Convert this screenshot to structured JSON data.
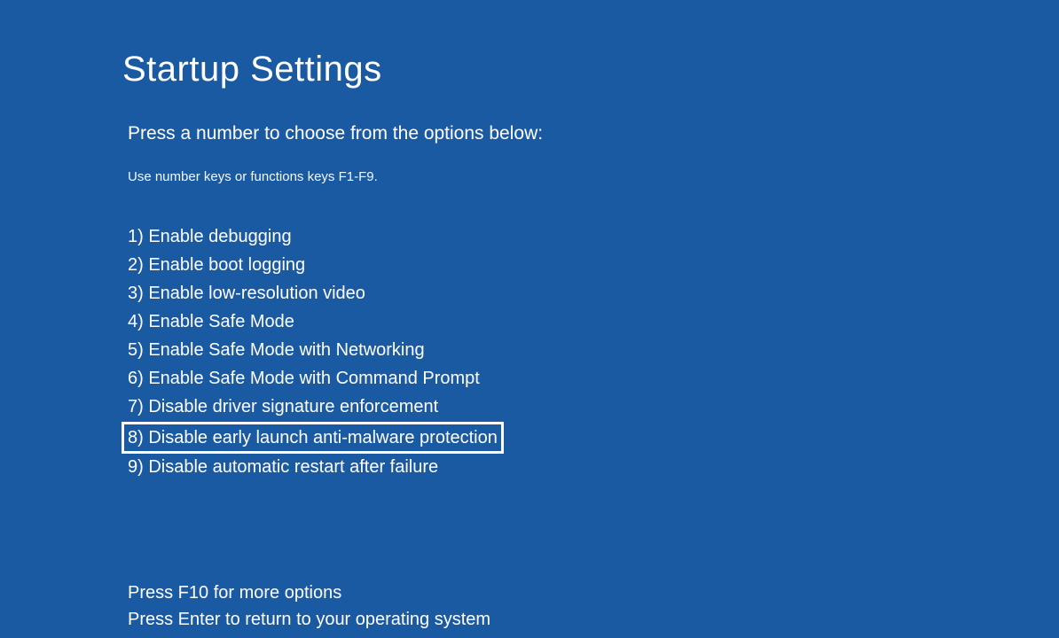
{
  "title": "Startup Settings",
  "subtitle": "Press a number to choose from the options below:",
  "hint": "Use number keys or functions keys F1-F9.",
  "options": [
    {
      "label": "1) Enable debugging",
      "highlighted": false
    },
    {
      "label": "2) Enable boot logging",
      "highlighted": false
    },
    {
      "label": "3) Enable low-resolution video",
      "highlighted": false
    },
    {
      "label": "4) Enable Safe Mode",
      "highlighted": false
    },
    {
      "label": "5) Enable Safe Mode with Networking",
      "highlighted": false
    },
    {
      "label": "6) Enable Safe Mode with Command Prompt",
      "highlighted": false
    },
    {
      "label": "7) Disable driver signature enforcement",
      "highlighted": false
    },
    {
      "label": "8) Disable early launch anti-malware protection",
      "highlighted": true
    },
    {
      "label": "9) Disable automatic restart after failure",
      "highlighted": false
    }
  ],
  "footer": {
    "line1": "Press F10 for more options",
    "line2": "Press Enter to return to your operating system"
  }
}
